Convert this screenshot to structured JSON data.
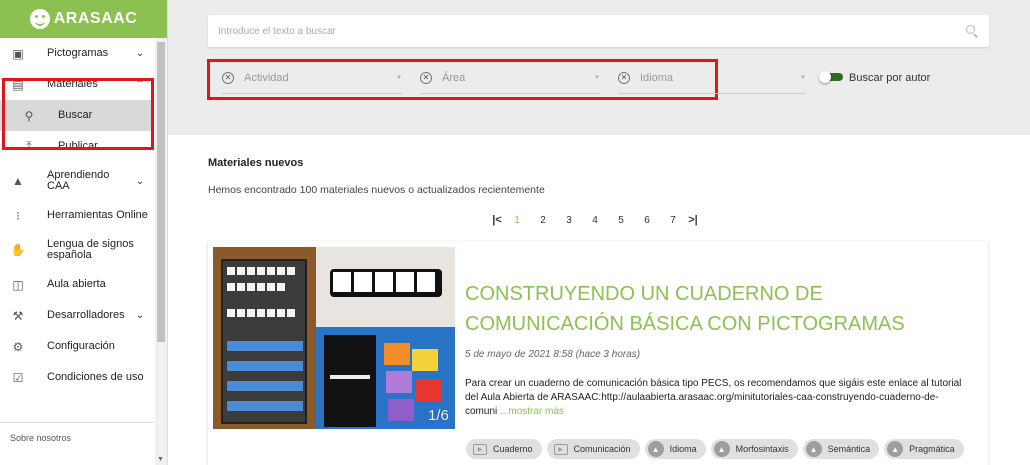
{
  "brand": {
    "name": "ARASAAC"
  },
  "sidebar": {
    "items": [
      {
        "label": "Pictogramas",
        "icon": "image-icon",
        "chevron": "down"
      },
      {
        "label": "Materiales",
        "icon": "library-icon",
        "chevron": "up"
      },
      {
        "label": "Buscar",
        "icon": "search-icon",
        "active": true
      },
      {
        "label": "Publicar",
        "icon": "upload-icon"
      },
      {
        "label": "Aprendiendo CAA",
        "icon": "school-icon",
        "chevron": "down"
      },
      {
        "label": "Herramientas Online",
        "icon": "apps-grid-icon"
      },
      {
        "label": "Lengua de signos española",
        "icon": "sign-language-icon"
      },
      {
        "label": "Aula abierta",
        "icon": "screen-icon"
      },
      {
        "label": "Desarrolladores",
        "icon": "wrench-icon",
        "chevron": "down"
      },
      {
        "label": "Configuración",
        "icon": "gear-icon"
      },
      {
        "label": "Condiciones de uso",
        "icon": "checkbox-icon"
      }
    ],
    "footer": "Sobre nosotros"
  },
  "search": {
    "placeholder": "Introduce el texto a buscar",
    "value": ""
  },
  "filters": [
    {
      "label": "Actividad"
    },
    {
      "label": "Área"
    },
    {
      "label": "Idioma"
    }
  ],
  "author_toggle": {
    "label": "Buscar por autor",
    "on": true
  },
  "materials": {
    "title": "Materiales nuevos",
    "subtitle": "Hemos encontrado 100 materiales nuevos o actualizados recientemente",
    "pagination": {
      "first": "|<",
      "pages": [
        "1",
        "2",
        "3",
        "4",
        "5",
        "6",
        "7"
      ],
      "current": "1",
      "last": ">|"
    },
    "card": {
      "title": "CONSTRUYENDO UN CUADERNO DE COMUNICACIÓN BÁSICA CON PICTOGRAMAS",
      "date": "5 de mayo de 2021 8:58 (hace 3 horas)",
      "description": "Para crear un cuaderno de comunicación básica tipo PECS, os recomendamos que sigáis este enlace al tutorial del Aula Abierta de ARASAAC:http://aulaabierta.arasaac.org/minitutoriales-caa-construyendo-cuaderno-de-comuni",
      "more": "...mostrar más",
      "image_counter": "1/6",
      "tags": [
        {
          "label": "Cuaderno",
          "icon": "activity-icon"
        },
        {
          "label": "Comunicación",
          "icon": "activity-icon"
        },
        {
          "label": "Idioma",
          "icon": "school-icon"
        },
        {
          "label": "Morfosintaxis",
          "icon": "school-icon"
        },
        {
          "label": "Semántica",
          "icon": "school-icon"
        },
        {
          "label": "Pragmática",
          "icon": "school-icon"
        }
      ]
    }
  },
  "colors": {
    "brand_green": "#8cc152",
    "highlight_red": "#e0161b"
  }
}
